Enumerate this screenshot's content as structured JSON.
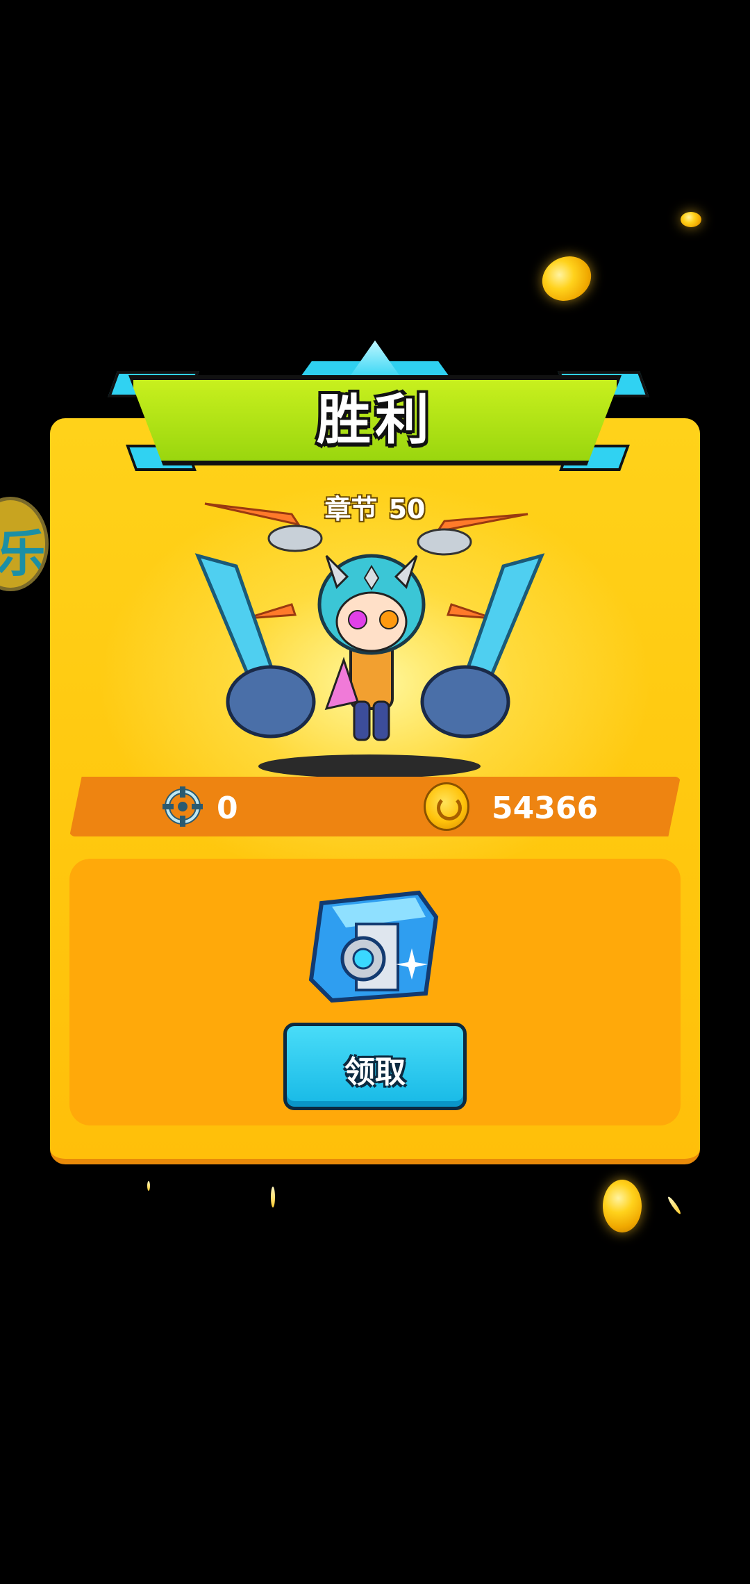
{
  "header": {
    "title": "胜利"
  },
  "chapter": {
    "label": "章节",
    "number": "50"
  },
  "stats": {
    "kills": "0",
    "gold": "54366"
  },
  "reward": {
    "claim_label": "领取"
  },
  "side_badge": {
    "glyph": "乐"
  },
  "colors": {
    "panel": "#ffc70e",
    "banner": "#9ad60e",
    "accent_cyan": "#2fd0f0",
    "stats_bar": "#ee8411"
  },
  "icons": [
    "target-icon",
    "gold-coin-icon",
    "treasure-chest-icon",
    "hero-character"
  ]
}
